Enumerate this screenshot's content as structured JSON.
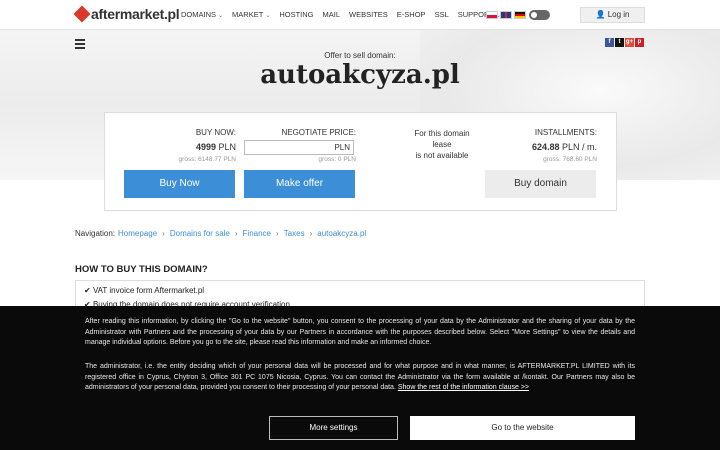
{
  "header": {
    "logo_text": "aftermarket.pl",
    "nav": [
      {
        "label": "DOMAINS",
        "dropdown": true
      },
      {
        "label": "MARKET",
        "dropdown": true
      },
      {
        "label": "HOSTING",
        "dropdown": false
      },
      {
        "label": "MAIL",
        "dropdown": false
      },
      {
        "label": "WEBSITES",
        "dropdown": false
      },
      {
        "label": "E-SHOP",
        "dropdown": false
      },
      {
        "label": "SSL",
        "dropdown": false
      },
      {
        "label": "SUPPORT",
        "dropdown": true
      }
    ],
    "login_label": "Log in"
  },
  "hero": {
    "offer_label": "Offer to sell domain:",
    "domain": "autoakcyza.pl",
    "social": [
      "f",
      "t",
      "g+",
      "p"
    ]
  },
  "offer": {
    "buy_now": {
      "label": "BUY NOW:",
      "value": "4999",
      "unit": "PLN",
      "gross": "gross: 6148.77 PLN",
      "button": "Buy Now"
    },
    "negotiate": {
      "label": "NEGOTIATE PRICE:",
      "input_unit": "PLN",
      "gross": "gross: 0 PLN",
      "button": "Make offer"
    },
    "lease": {
      "line1": "For this domain",
      "line2": "lease",
      "line3": "is not available"
    },
    "installments": {
      "label": "INSTALLMENTS:",
      "value": "624.88",
      "unit": "PLN / m.",
      "gross": "gross: 768.60 PLN",
      "button": "Buy domain"
    }
  },
  "breadcrumb": {
    "label": "Navigation:",
    "items": [
      "Homepage",
      "Domains for sale",
      "Finance",
      "Taxes",
      "autoakcyza.pl"
    ]
  },
  "howto": {
    "title": "HOW TO BUY THIS DOMAIN?",
    "items": [
      "VAT invoice form Aftermarket.pl",
      "Buying the domain does not require account verification"
    ]
  },
  "cookie": {
    "p1": "After reading this information, by clicking the \"Go to the website\" button, you consent to the processing of your data by the Administrator and the sharing of your data by the Administrator with Partners and the processing of your data by our Partners in accordance with the purposes described below. Select \"More Settings\" to view the details and manage individual options. Before you go to the site, please read this information and make an informed choice.",
    "p2": "The administrator, i.e. the entity deciding which of your personal data will be processed and for what purpose and in what manner, is AFTERMARKET.PL LIMITED with its registered office in Cyprus, Chytron 3, Office 301 PC 1075 Nicosia, Cyprus. You can contact the Administrator via the form available at /kontakt. Our Partners may also be administrators of your personal data, provided you consent to their processing of your personal data.",
    "p2_link": "Show the rest of the information clause >>",
    "settings_button": "More settings",
    "go_button": "Go to the website"
  },
  "colors": {
    "accent": "#3c8fd6",
    "logo_red": "#d9382b",
    "overlay": "#0a0a0a"
  }
}
